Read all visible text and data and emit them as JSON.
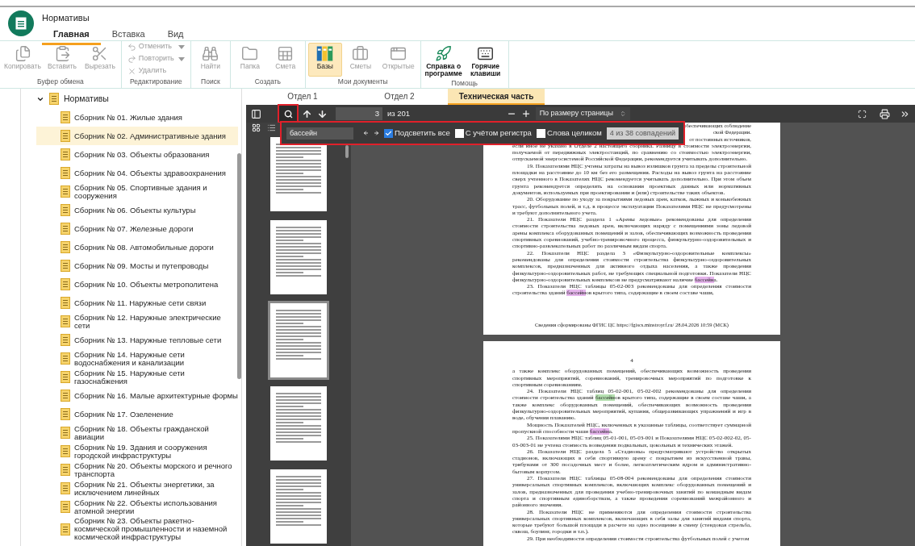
{
  "app": {
    "title": "Нормативы"
  },
  "menu_tabs": [
    {
      "label": "Главная",
      "selected": true
    },
    {
      "label": "Вставка",
      "selected": false
    },
    {
      "label": "Вид",
      "selected": false
    }
  ],
  "ribbon": [
    {
      "label": "Буфер обмена",
      "buttons": [
        {
          "label": "Копировать",
          "kind": "large",
          "disabled": true,
          "selected": false
        },
        {
          "label": "Вставить",
          "kind": "large",
          "disabled": true,
          "selected": false
        },
        {
          "label": "Вырезать",
          "kind": "large",
          "disabled": true,
          "selected": false
        }
      ]
    },
    {
      "label": "Редактирование",
      "buttons": [
        {
          "label": "Отменить",
          "kind": "small",
          "disabled": true,
          "selected": false,
          "dropdown": true
        },
        {
          "label": "Повторить",
          "kind": "small",
          "disabled": true,
          "selected": false,
          "dropdown": true
        },
        {
          "label": "Удалить",
          "kind": "small",
          "disabled": true,
          "selected": false,
          "dropdown": false
        }
      ]
    },
    {
      "label": "Поиск",
      "buttons": [
        {
          "label": "Найти",
          "kind": "large",
          "disabled": true,
          "selected": false
        }
      ]
    },
    {
      "label": "Создать",
      "buttons": [
        {
          "label": "Папка",
          "kind": "large",
          "disabled": true,
          "selected": false
        },
        {
          "label": "Смета",
          "kind": "large",
          "disabled": true,
          "selected": false
        }
      ]
    },
    {
      "label": "Мои документы",
      "buttons": [
        {
          "label": "Базы",
          "kind": "large",
          "disabled": false,
          "selected": true
        },
        {
          "label": "Сметы",
          "kind": "large",
          "disabled": true,
          "selected": false
        },
        {
          "label": "Открытые",
          "kind": "large",
          "disabled": true,
          "selected": false
        }
      ]
    },
    {
      "label": "Помощь",
      "buttons": [
        {
          "label": "Справка о программе",
          "kind": "large",
          "disabled": false,
          "selected": false
        },
        {
          "label": "Горячие клавиши",
          "kind": "large",
          "disabled": false,
          "selected": false
        }
      ]
    }
  ],
  "tree": {
    "label": "Нормативы",
    "expanded": true,
    "children": [
      {
        "label": "Сборник № 01. Жилые здания",
        "selected": false
      },
      {
        "label": "Сборник № 02. Административные здания",
        "selected": true
      },
      {
        "label": "Сборник № 03. Объекты образования",
        "selected": false
      },
      {
        "label": "Сборник № 04. Объекты здравоохранения",
        "selected": false
      },
      {
        "label": "Сборник № 05. Спортивные здания и сооружения",
        "selected": false
      },
      {
        "label": "Сборник № 06. Объекты культуры",
        "selected": false
      },
      {
        "label": "Сборник № 07. Железные дороги",
        "selected": false
      },
      {
        "label": "Сборник № 08. Автомобильные дороги",
        "selected": false
      },
      {
        "label": "Сборник № 09. Мосты и путепроводы",
        "selected": false
      },
      {
        "label": "Сборник № 10. Объекты метрополитена",
        "selected": false
      },
      {
        "label": "Сборник № 11. Наружные сети связи",
        "selected": false
      },
      {
        "label": "Сборник № 12. Наружные электрические сети",
        "selected": false
      },
      {
        "label": "Сборник № 13. Наружные тепловые сети",
        "selected": false
      },
      {
        "label": "Сборник № 14. Наружные сети водоснабжения и канализации",
        "selected": false
      },
      {
        "label": "Сборник № 15. Наружные сети газоснабжения",
        "selected": false
      },
      {
        "label": "Сборник № 16. Малые архитектурные формы",
        "selected": false
      },
      {
        "label": "Сборник № 17. Озеленение",
        "selected": false
      },
      {
        "label": "Сборник № 18. Объекты гражданской авиации",
        "selected": false
      },
      {
        "label": "Сборник № 19. Здания и сооружения городской инфраструктуры",
        "selected": false
      },
      {
        "label": "Сборник № 20. Объекты морского и речного транспорта",
        "selected": false
      },
      {
        "label": "Сборник № 21. Объекты энергетики, за исключением линейных",
        "selected": false
      },
      {
        "label": "Сборник № 22. Объекты использования атомной энергии",
        "selected": false
      },
      {
        "label": "Сборник № 23. Объекты ракетно-космической промышленности и наземной космической инфраструктуры",
        "selected": false
      }
    ]
  },
  "doc_tabs": [
    {
      "label": "Отдел 1",
      "selected": false
    },
    {
      "label": "Отдел 2",
      "selected": false
    },
    {
      "label": "Техническая часть",
      "selected": true
    }
  ],
  "viewer_toolbar": {
    "search_button": {
      "selected": true,
      "annotated": true
    },
    "page": "3",
    "page_total": "из 201",
    "zoom": "По размеру страницы"
  },
  "search_bar": {
    "annotated": true,
    "value": "бассейн",
    "options": [
      {
        "label": "Подсветить все",
        "checked": true
      },
      {
        "label": "С учётом регистра",
        "checked": false
      },
      {
        "label": "Слова целиком",
        "checked": false
      }
    ],
    "result": "4 из 38 совпадений"
  },
  "thumbnails": [
    {
      "selected": false
    },
    {
      "selected": false
    },
    {
      "selected": true
    },
    {
      "selected": false
    },
    {
      "selected": false
    }
  ],
  "pages": [
    {
      "fragments": [
        "обеспечивающих соблюдение",
        "ской Федерации.",
        "от постоянных источников,"
      ],
      "paragraphs": [
        {
          "indent": false,
          "segments": [
            {
              "text": "если иное не указано в Отделе 2 настоящего сборника. Разницу в стоимости электроэнергии, получаемой от передвижных электростанций, по сравнению со стоимостью электроэнергии, отпускаемой энергосистемой Российской Федерации, рекомендуется учитывать дополнительно.",
              "kind": "text"
            }
          ]
        },
        {
          "indent": true,
          "segments": [
            {
              "text": "19. Показателями НЦС учтены затраты на вывоз излишков грунта за пределы строительной площадки на расстояние до 10 км без его размещения. Расходы на вывоз грунта на расстояние сверх учтенного в Показателях НЦС рекомендуется учитывать дополнительно. При этом объем грунта рекомендуется определять на основании проектных данных или нормативных документов, используемых при проектировании и (или) строительстве таких объектов.",
              "kind": "text"
            }
          ]
        },
        {
          "indent": true,
          "segments": [
            {
              "text": "20. Оборудование по уходу за покрытиями ледовых арен, катков, лыжных и конькобежных трасс, футбольных полей, и т.д. в процессе эксплуатации Показателями НЦС не предусмотрены и требуют дополнительного учета.",
              "kind": "text"
            }
          ]
        },
        {
          "indent": true,
          "segments": [
            {
              "text": "21. Показатели НЦС раздела 1 «Арены ледовые» рекомендованы для определения стоимости строительства ледовых арен, включающих наряду с помещениями зоны ледовой арены комплекса оборудованных помещений и залов, обеспечивающих возможность проведения спортивных соревнований, учебно-тренировочного процесса, физкультурно-оздоровительных и спортивно-развлекательных работ по различным видам спорта.",
              "kind": "text"
            }
          ]
        },
        {
          "indent": true,
          "segments": [
            {
              "text": "22. Показатели НЦС раздела 3 «Физкультурно-оздоровительные комплексы» рекомендованы для определения стоимости строительства физкультурно-оздоровительных комплексов, предназначенных для активного отдыха населения, а также проведения физкультурно-оздоровительных работ, не требующих специальной подготовки. Показатели НЦС физкультурно-оздоровительных комплексов не предусматривают наличие ",
              "kind": "text"
            },
            {
              "text": "бассейн",
              "kind": "match"
            },
            {
              "text": "а.",
              "kind": "text"
            }
          ]
        },
        {
          "indent": true,
          "segments": [
            {
              "text": "23. Показатели НЦС таблицы 05-02-003 рекомендованы для определения стоимости строительства зданий ",
              "kind": "text"
            },
            {
              "text": "бассейн",
              "kind": "match"
            },
            {
              "text": "ов крытого типа, содержащие в своем составе чаши,",
              "kind": "text"
            }
          ]
        }
      ],
      "footer": "Сведения сформированы ФГИС ЦС https://fgiscs.minstroyrf.ru/ 28.04.2026 10:59 (МСК)"
    },
    {
      "number": "4",
      "paragraphs": [
        {
          "indent": false,
          "segments": [
            {
              "text": "а также комплекс оборудованных помещений, обеспечивающих возможность проведения спортивных мероприятий, соревнований, тренировочных мероприятий по подготовке к спортивным соревнованиям.",
              "kind": "text"
            }
          ]
        },
        {
          "indent": true,
          "segments": [
            {
              "text": "24. Показатели НЦС таблиц 05-02-001, 05-02-002 рекомендованы для определения стоимости строительства зданий ",
              "kind": "text"
            },
            {
              "text": "бассейн",
              "kind": "current_match"
            },
            {
              "text": "ов крытого типа, содержащие в своем составе чаши, а также комплекс оборудованных помещений, обеспечивающих возможность проведения физкультурно-оздоровительных мероприятий, купания, общеразвивающих упражнений и игр в воде, обучения плаванию.",
              "kind": "text"
            }
          ]
        },
        {
          "indent": true,
          "segments": [
            {
              "text": "Мощность Показателей НЦС, включенных в указанные таблицы, соответствует суммарной пропускной способности чаши ",
              "kind": "text"
            },
            {
              "text": "бассейн",
              "kind": "match"
            },
            {
              "text": "а.",
              "kind": "text"
            }
          ]
        },
        {
          "indent": true,
          "segments": [
            {
              "text": "25. Показателями НЦС таблиц 05-01-001, 05-03-001 и Показателями НЦС 05-02-002-02, 05-03-003-01 не учтена стоимость возведения подвальных, цокольных и технических этажей.",
              "kind": "text"
            }
          ]
        },
        {
          "indent": true,
          "segments": [
            {
              "text": "26. Показатели НЦС раздела 5 «Стадионы» предусматривают устройство открытых стадионов, включающих в себя спортивную арену с покрытием из искусственной травы, трибунами от 300 посадочных мест и более, легкоатлетическим ядром и административно-бытовым корпусом.",
              "kind": "text"
            }
          ]
        },
        {
          "indent": true,
          "segments": [
            {
              "text": "27. Показатели НЦС таблицы 05-08-004 рекомендованы для определения стоимости универсальных спортивных комплексов, включающих комплекс оборудованных помещений и залов, предназначенных для проведения учебно-тренировочных занятий по командным видам спорта и спортивным единоборствам, а также проведения соревнований межрайонного и районного значения.",
              "kind": "text"
            }
          ]
        },
        {
          "indent": true,
          "segments": [
            {
              "text": "28. Показатели НЦС не применяются для определения стоимости строительства универсальных спортивных комплексов, включающих в себя залы для занятий видами спорта, которые требуют большой площади в расчете на одно посещение в смену (стендовая стрельба, сквош, боулинг, городки и т.п.).",
              "kind": "text"
            }
          ]
        },
        {
          "indent": true,
          "segments": [
            {
              "text": "29. При необходимости определения стоимости строительства футбольных полей с учетом",
              "kind": "text"
            }
          ]
        }
      ]
    }
  ]
}
